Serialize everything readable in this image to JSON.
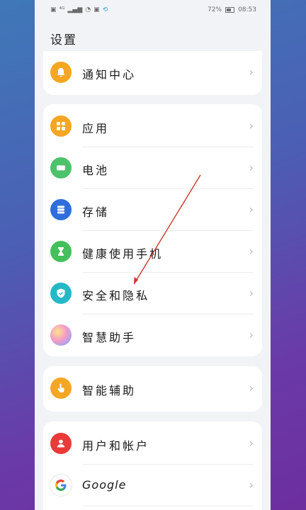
{
  "status": {
    "left_icons": [
      "sim-icon",
      "hd-icon",
      "signal-icon",
      "wifi-icon",
      "nfc-icon",
      "sync-icon"
    ],
    "battery": "72%",
    "time": "08:53"
  },
  "page_title": "设置",
  "cards": [
    {
      "items": [
        {
          "label": "通知中心",
          "icon": "bell-icon",
          "color": "#f5a623"
        }
      ]
    },
    {
      "items": [
        {
          "label": "应用",
          "icon": "apps-icon",
          "color": "#f5a623"
        },
        {
          "label": "电池",
          "icon": "battery-icon",
          "color": "#4cc26a"
        },
        {
          "label": "存储",
          "icon": "storage-icon",
          "color": "#2f6fdc"
        },
        {
          "label": "健康使用手机",
          "icon": "hourglass-icon",
          "color": "#43c05c"
        },
        {
          "label": "安全和隐私",
          "icon": "shield-icon",
          "color": "#25b8c6"
        },
        {
          "label": "智慧助手",
          "icon": "assistant-icon",
          "color": "#d98ad8"
        }
      ]
    },
    {
      "items": [
        {
          "label": "智能辅助",
          "icon": "hand-icon",
          "color": "#f5a623"
        }
      ]
    },
    {
      "items": [
        {
          "label": "用户和帐户",
          "icon": "user-icon",
          "color": "#ea3a3a"
        },
        {
          "label": "Google",
          "icon": "google-icon",
          "color": "#ffffff"
        }
      ]
    }
  ]
}
